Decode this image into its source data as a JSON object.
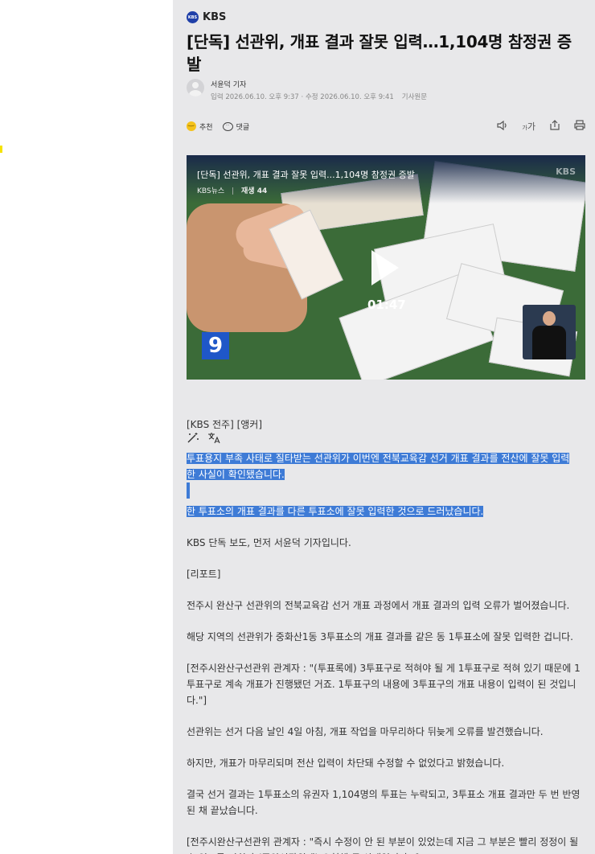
{
  "source": {
    "logo": "KBS",
    "name": "KBS"
  },
  "article": {
    "headline": "[단독] 선관위, 개표 결과 잘못 입력…1,104명 참정권 증발",
    "reporter": "서윤덕 기자",
    "input_time": "입력 2026.06.10. 오후 9:37 · 수정 2026.06.10. 오후 9:41",
    "original_link": "기사원문"
  },
  "actions": {
    "recommend": "추천",
    "comment": "댓글",
    "icons": [
      "speaker-icon",
      "font-size-icon",
      "share-icon",
      "print-icon"
    ],
    "font_size_label": "가"
  },
  "video": {
    "title": "[단독] 선관위, 개표 결과 잘못 입력...1,104명 참정권 증발",
    "source_label": "KBS뉴스",
    "play_count": "재생 44",
    "duration": "01:47",
    "watermark": "KBS",
    "channel_badge": "9"
  },
  "body": {
    "p1": "[KBS 전주] [앵커]",
    "p2a": "투표용지 부족 사태로 질타받는 선관위가 이번엔 전북교육감 선거 개표 결과를 전산에 잘못 입력",
    "p2b": "한 사실이 확인됐습니다.",
    "p3": "한 투표소의 개표 결과를 다른 투표소에 잘못 입력한 것으로 드러났습니다.",
    "p4": "KBS 단독 보도, 먼저 서윤덕 기자입니다.",
    "p5": "[리포트]",
    "p6": "전주시 완산구 선관위의 전북교육감 선거 개표 과정에서 개표 결과의 입력 오류가 벌어졌습니다.",
    "p7": "해당 지역의 선관위가 중화산1동 3투표소의 개표 결과를 같은 동 1투표소에 잘못 입력한 겁니다.",
    "p8": "[전주시완산구선관위 관계자 : \"(투표록에) 3투표구로 적혀야 될 게 1투표구로 적혀 있기 때문에 1투표구로 계속 개표가 진행됐던 거죠. 1투표구의 내용에 3투표구의 개표 내용이 입력이 된 것입니다.\"]",
    "p9": "선관위는 선거 다음 날인 4일 아침, 개표 작업을 마무리하다 뒤늦게 오류를 발견했습니다.",
    "p10": "하지만, 개표가 마무리되며 전산 입력이 차단돼 수정할 수 없었다고 밝혔습니다.",
    "p11": "결국 선거 결과는 1투표소의 유권자 1,104명의 투표는 누락되고, 3투표소 개표 결과만 두 번 반영된 채 끝났습니다.",
    "p12": "[전주시완산구선관위 관계자 : \"즉시 수정이 안 된 부분이 있었는데 지금 그 부분은 빨리 정정이 될 수 있도록 저희가 (중앙선관위에) 요청해 둔 상태입니다.\"]"
  }
}
